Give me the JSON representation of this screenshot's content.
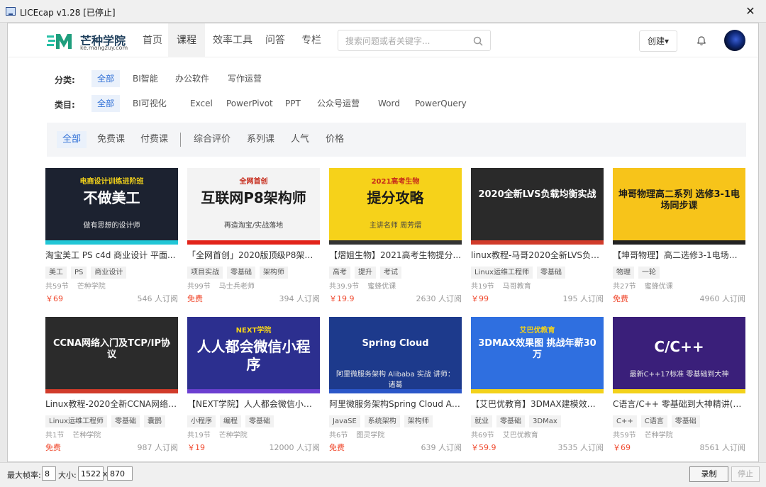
{
  "window": {
    "title": "LICEcap v1.28 [已停止]",
    "close": "✕"
  },
  "header": {
    "logo_name": "芒种学院",
    "logo_sub": "ke.mangzuy.com",
    "nav": [
      "首页",
      "课程",
      "效率工具",
      "问答",
      "专栏"
    ],
    "search_placeholder": "搜索问题或者关键字...",
    "create": "创建▾"
  },
  "filters": {
    "category_label": "分类:",
    "categories": [
      "全部",
      "BI智能",
      "办公软件",
      "写作运营"
    ],
    "type_label": "类目:",
    "types": [
      "全部",
      "BI可视化",
      "Excel",
      "PowerPivot",
      "PPT",
      "公众号运营",
      "Word",
      "PowerQuery"
    ]
  },
  "sort": {
    "left": [
      "全部",
      "免费课",
      "付费课"
    ],
    "separator": "|",
    "right": [
      "综合评价",
      "系列课",
      "人气",
      "价格"
    ]
  },
  "courses": [
    {
      "title": "淘宝美工 PS c4d 商业设计 平面...",
      "tags": [
        "美工",
        "PS",
        "商业设计"
      ],
      "lessons": "共59节",
      "org": "芒种学院",
      "price": "￥69",
      "subs": "546 人订阅",
      "cover": {
        "line1": "电商设计训练进阶班",
        "line2": "不做美工",
        "line3": "做有思想的设计师",
        "bg": "#1c2230",
        "accent": "#21c6d6"
      }
    },
    {
      "title": "「全网首创」2020版顶级P8架构...",
      "tags": [
        "项目实战",
        "零基础",
        "架构师"
      ],
      "lessons": "共99节",
      "org": "马士兵老师",
      "price": "免费",
      "subs": "394 人订阅",
      "cover": {
        "line1": "全网首创",
        "line2": "互联网P8架构师",
        "line3": "再造淘宝/实战落地",
        "bg": "#f3f3f3",
        "accent": "#e2231a"
      }
    },
    {
      "title": "【熠姐生物】2021高考生物提分...",
      "tags": [
        "高考",
        "提升",
        "考试"
      ],
      "lessons": "共39.9节",
      "org": "蜜蜂优课",
      "price": "￥19.9",
      "subs": "2630 人订阅",
      "cover": {
        "line1": "2021高考生物",
        "line2": "提分攻略",
        "line3": "主讲名师 周芳熠",
        "bg": "#f6d21a",
        "accent": "#333333"
      }
    },
    {
      "title": "linux教程-马哥2020全新LVS负载...",
      "tags": [
        "Linux运维工程师",
        "零基础"
      ],
      "lessons": "共19节",
      "org": "马哥教育",
      "price": "￥99",
      "subs": "195 人订阅",
      "cover": {
        "line1": "",
        "line2": "2020全新LVS负载均衡实战",
        "line3": "",
        "bg": "#2a2a2a",
        "accent": "#d13b2a"
      }
    },
    {
      "title": "【坤哥物理】高二选修3-1电场同...",
      "tags": [
        "物理",
        "一轮"
      ],
      "lessons": "共27节",
      "org": "蜜蜂优课",
      "price": "免费",
      "subs": "4960 人订阅",
      "cover": {
        "line1": "",
        "line2": "坤哥物理高二系列 选修3-1电场同步课",
        "line3": "",
        "bg": "#f7c41a",
        "accent": "#222222"
      }
    },
    {
      "title": "Linux教程-2020全新CCNA网络入...",
      "tags": [
        "Linux运维工程师",
        "零基础",
        "囊鹊"
      ],
      "lessons": "共1节",
      "org": "芒种学院",
      "price": "免费",
      "subs": "987 人订阅",
      "cover": {
        "line1": "",
        "line2": "CCNA网络入门及TCP/IP协议",
        "line3": "",
        "bg": "#2b2b2b",
        "accent": "#d13b2a"
      }
    },
    {
      "title": "【NEXT学院】人人都会微信小程序",
      "tags": [
        "小程序",
        "编程",
        "零基础"
      ],
      "lessons": "共19节",
      "org": "芒种学院",
      "price": "￥19",
      "subs": "12000 人订阅",
      "cover": {
        "line1": "NEXT学院",
        "line2": "人人都会微信小程序",
        "line3": "",
        "bg": "#2c2f8f",
        "accent": "#6b3fd1"
      }
    },
    {
      "title": "阿里微服务架构Spring Cloud Alib...",
      "tags": [
        "JavaSE",
        "系统架构",
        "架构师"
      ],
      "lessons": "共6节",
      "org": "图灵学院",
      "price": "免费",
      "subs": "639 人订阅",
      "cover": {
        "line1": "",
        "line2": "Spring Cloud",
        "line3": "阿里微服务架构 Alibaba 实战 讲师：诸葛",
        "bg": "#1d3a8c",
        "accent": "#2b57c9"
      }
    },
    {
      "title": "【艾巴优教育】3DMAX建模效果...",
      "tags": [
        "就业",
        "零基础",
        "3DMax"
      ],
      "lessons": "共69节",
      "org": "艾巴优教育",
      "price": "￥59.9",
      "subs": "3535 人订阅",
      "cover": {
        "line1": "艾巴优教育",
        "line2": "3DMAX效果图 挑战年薪30万",
        "line3": "",
        "bg": "#2f6fe0",
        "accent": "#f3d21a"
      }
    },
    {
      "title": "C语言/C++ 零基础到大神精讲(C++1...",
      "tags": [
        "C++",
        "C语言",
        "零基础"
      ],
      "lessons": "共59节",
      "org": "芒种学院",
      "price": "￥69",
      "subs": "8561 人订阅",
      "cover": {
        "line1": "",
        "line2": "C/C++",
        "line3": "最新C++17标准 零基础到大神",
        "bg": "#3a1f7a",
        "accent": "#f3d21a"
      }
    }
  ],
  "bottom": {
    "fps_label": "最大帧率:",
    "fps": "8",
    "size_label": "大小:",
    "width": "1522",
    "x": "x",
    "height": "870",
    "record": "录制",
    "stop": "停止"
  }
}
